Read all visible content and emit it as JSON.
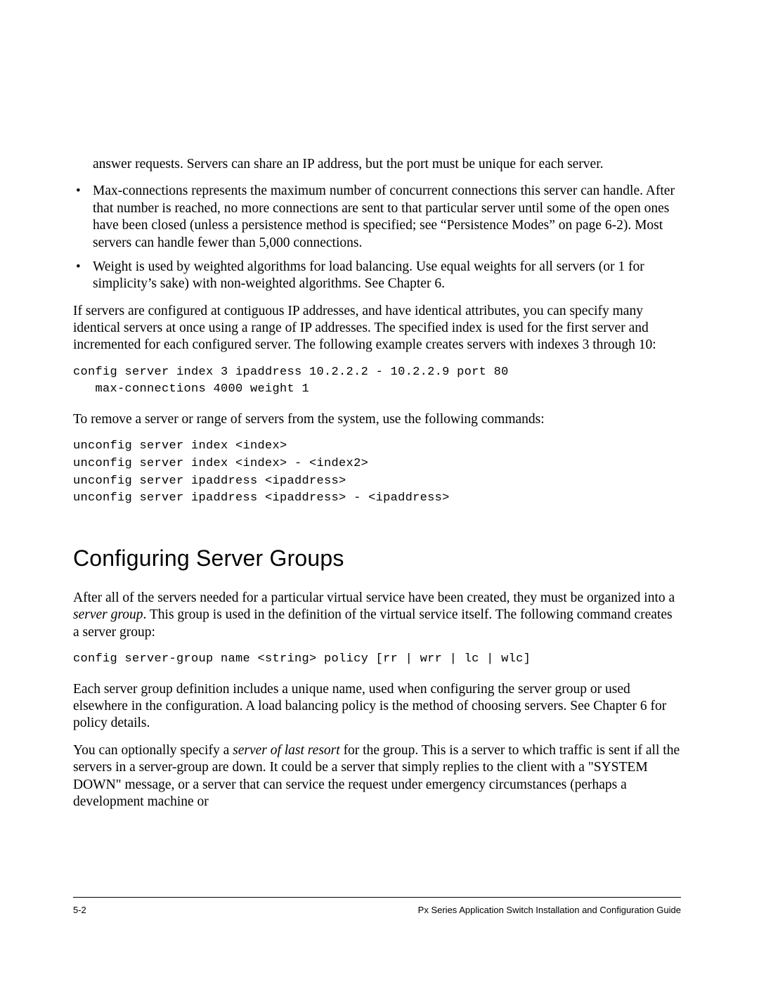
{
  "paragraphs": {
    "p0": "answer requests. Servers can share an IP address, but the port must be unique for each server.",
    "bullet1": "Max-connections represents the maximum number of concurrent connections this server can handle. After that number is reached, no more connections are sent to that particular server until some of the open ones have been closed (unless a persistence method is specified; see “Persistence Modes” on page 6-2). Most servers can handle fewer than 5,000 connections.",
    "bullet2": "Weight is used by weighted algorithms for load balancing. Use equal weights for all servers (or 1 for simplicity’s sake) with non-weighted algorithms. See Chapter 6.",
    "p1": "If servers are configured at contiguous IP addresses, and have identical attributes, you can specify many identical servers at once using a range of IP addresses. The specified index is used for the first server and incremented for each configured server. The following example creates servers with indexes 3 through 10:",
    "code1": "config server index 3 ipaddress 10.2.2.2 - 10.2.2.9 port 80\n   max-connections 4000 weight 1",
    "p2": "To remove a server or range of servers from the system, use the following commands:",
    "code2": "unconfig server index <index>\nunconfig server index <index> - <index2>\nunconfig server ipaddress <ipaddress>\nunconfig server ipaddress <ipaddress> - <ipaddress>",
    "h2": "Configuring Server Groups",
    "p3a": "After all of the servers needed for a particular virtual service have been created, they must be organized into a ",
    "p3em": "server group",
    "p3b": ". This group is used in the definition of the virtual service itself. The following command creates a server group:",
    "code3": "config server-group name <string> policy [rr | wrr | lc | wlc]",
    "p4": "Each server group definition includes a unique name, used when configuring the server group or used elsewhere in the configuration. A load balancing policy is the method of choosing servers. See Chapter 6 for policy details.",
    "p5a": "You can optionally specify a ",
    "p5em": "server of last resort",
    "p5b": " for the group. This is a server to which traffic is sent if all the servers in a server-group are down.  It could be a server that simply replies to the client with a \"SYSTEM DOWN\" message, or a server that can service the request under emergency circumstances (perhaps a development machine or"
  },
  "footer": {
    "left": "5-2",
    "right": "Px Series Application Switch Installation and Configuration Guide"
  }
}
